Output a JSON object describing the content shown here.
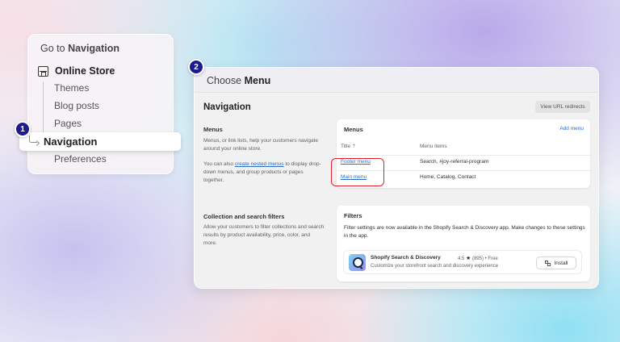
{
  "nav_panel": {
    "title_prefix": "Go to",
    "title_strong": "Navigation",
    "store_label": "Online Store",
    "items": [
      "Themes",
      "Blog posts",
      "Pages"
    ],
    "active_item": "Navigation",
    "after_item": "Preferences",
    "step": "1"
  },
  "window": {
    "step": "2",
    "title_prefix": "Choose",
    "title_strong": "Menu",
    "page_title": "Navigation",
    "url_redirects_button": "View URL redirects",
    "menus_section": {
      "heading": "Menus",
      "desc1": "Menus, or link lists, help your customers navigate around your online store.",
      "desc2_before": "You can also",
      "desc2_link": "create nested menus",
      "desc2_after": "to display drop-down menus, and group products or pages together."
    },
    "menus_card": {
      "title": "Menus",
      "add_menu": "Add menu",
      "col_title": "Title",
      "col_items": "Menu items",
      "rows": [
        {
          "title": "Footer menu",
          "items": "Search, #joy-referral-program"
        },
        {
          "title": "Main menu",
          "items": "Home, Catalog, Contact"
        }
      ]
    },
    "filters_section": {
      "heading": "Collection and search filters",
      "desc": "Allow your customers to filter collections and search results by product availability, price, color, and more."
    },
    "filters_card": {
      "title": "Filters",
      "text": "Filter settings are now available in the Shopify Search & Discovery app. Make changes to these settings in the app.",
      "app": {
        "name": "Shopify Search & Discovery",
        "rating": "4.5",
        "reviews": "(895) • Free",
        "description": "Customize your storefront search and discovery experience",
        "install": "Install"
      }
    }
  },
  "colors": {
    "badge": "#1d1a8f",
    "link": "#2c6ecb",
    "highlight": "#e0212c"
  }
}
